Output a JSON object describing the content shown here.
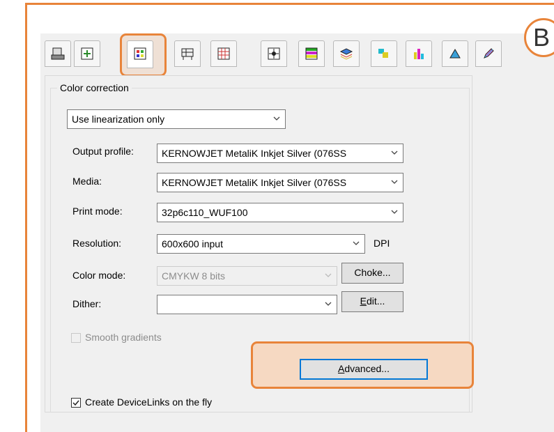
{
  "badge": {
    "letter": "B"
  },
  "tabs": [
    {
      "icon": "printer-icon"
    },
    {
      "icon": "page-layout-icon"
    },
    {
      "icon": "color-correction-icon",
      "active": true
    },
    {
      "icon": "printer-setup-icon"
    },
    {
      "icon": "grid-icon"
    },
    {
      "icon": "target-icon"
    },
    {
      "icon": "color-bars-icon"
    },
    {
      "icon": "layers-icon"
    },
    {
      "icon": "color-blocks-icon"
    },
    {
      "icon": "ink-bars-icon"
    },
    {
      "icon": "gamut-icon"
    },
    {
      "icon": "pen-icon"
    }
  ],
  "group_label": "Color correction",
  "correction_mode": {
    "value": "Use linearization only"
  },
  "fields": {
    "output_profile": {
      "label": "Output profile:",
      "value": "KERNOWJET MetaliK Inkjet Silver (076SS"
    },
    "media": {
      "label": "Media:",
      "value": "KERNOWJET MetaliK Inkjet Silver (076SS"
    },
    "print_mode": {
      "label": "Print mode:",
      "value": "32p6c110_WUF100"
    },
    "resolution": {
      "label": "Resolution:",
      "value": "600x600 input",
      "unit": "DPI"
    },
    "color_mode": {
      "label": "Color mode:",
      "value": "CMYKW 8 bits",
      "disabled": true
    },
    "dither": {
      "label": "Dither:",
      "value": ""
    }
  },
  "buttons": {
    "choke": "Choke...",
    "edit_accel": "E",
    "edit_rest": "dit...",
    "advanced_accel": "A",
    "advanced_rest": "dvanced..."
  },
  "smooth_gradients": {
    "label": "Smooth gradients",
    "checked": false,
    "disabled": true
  },
  "device_links": {
    "label": "Create DeviceLinks on the fly",
    "checked": true
  },
  "colors": {
    "highlight": "#e8843a",
    "highlight_fill": "#f6d9c2",
    "focus": "#0078d7"
  }
}
